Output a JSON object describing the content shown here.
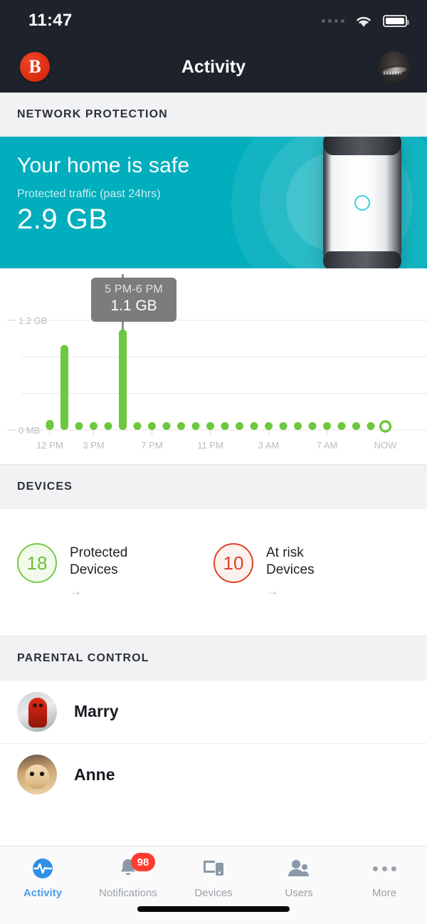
{
  "status_bar": {
    "time": "11:47",
    "signal_icon": "signal-dots-icon",
    "wifi_icon": "wifi-icon",
    "battery_icon": "battery-icon"
  },
  "nav_bar": {
    "brand_letter": "B",
    "title": "Activity",
    "avatar_icon": "user-avatar"
  },
  "sections": {
    "network_protection": "NETWORK PROTECTION",
    "devices": "DEVICES",
    "parental_control": "PARENTAL CONTROL"
  },
  "hero": {
    "title": "Your home is safe",
    "subtitle": "Protected traffic (past 24hrs)",
    "value": "2.9 GB",
    "accent_color": "#00aebd",
    "router_icon": "router-device-icon"
  },
  "tooltip": {
    "range": "5 PM-6 PM",
    "value": "1.1 GB"
  },
  "devices": [
    {
      "count": "18",
      "line1": "Protected",
      "line2": "Devices",
      "color": "#7ac943",
      "arrow": "→"
    },
    {
      "count": "10",
      "line1": "At risk",
      "line2": "Devices",
      "color": "#dc4327",
      "arrow": "→"
    }
  ],
  "parental_control": [
    {
      "name": "Marry",
      "avatar": "avatar-marry"
    },
    {
      "name": "Anne",
      "avatar": "avatar-anne"
    }
  ],
  "tabs": [
    {
      "label": "Activity",
      "icon": "activity-pulse-icon",
      "active": true,
      "badge": null
    },
    {
      "label": "Notifications",
      "icon": "bell-icon",
      "active": false,
      "badge": "98"
    },
    {
      "label": "Devices",
      "icon": "devices-icon",
      "active": false,
      "badge": null
    },
    {
      "label": "Users",
      "icon": "users-icon",
      "active": false,
      "badge": null
    },
    {
      "label": "More",
      "icon": "ellipsis-icon",
      "active": false,
      "badge": null
    }
  ],
  "chart_data": {
    "type": "bar",
    "title": "",
    "xlabel": "",
    "ylabel": "",
    "ylim": [
      0,
      1.45
    ],
    "y_unit": "GB",
    "grid": true,
    "legend": false,
    "bar_color": "#6cc83c",
    "y_tick_labels": [
      "0 MB",
      "1.2 GB"
    ],
    "y_tick_values": [
      0,
      1.2
    ],
    "gridline_values": [
      0,
      0.4,
      0.8,
      1.2
    ],
    "x_tick_labels": [
      "12 PM",
      "3 PM",
      "7 PM",
      "11 PM",
      "3 AM",
      "7 AM",
      "NOW"
    ],
    "x_tick_hours": [
      0,
      3,
      7,
      11,
      15,
      19,
      23
    ],
    "highlight_index": 5,
    "highlight_label": "5 PM-6 PM",
    "highlight_value": "1.1 GB",
    "last_point_hollow": true,
    "categories": [
      "12 PM",
      "1 PM",
      "2 PM",
      "3 PM",
      "4 PM",
      "5 PM",
      "6 PM",
      "7 PM",
      "8 PM",
      "9 PM",
      "10 PM",
      "11 PM",
      "12 AM",
      "1 AM",
      "2 AM",
      "3 AM",
      "4 AM",
      "5 AM",
      "6 AM",
      "7 AM",
      "8 AM",
      "9 AM",
      "10 AM",
      "NOW"
    ],
    "values": [
      0.11,
      0.93,
      0.07,
      0.01,
      0.01,
      1.1,
      0.01,
      0.01,
      0.01,
      0.01,
      0.01,
      0.01,
      0.01,
      0.01,
      0.01,
      0.01,
      0.01,
      0.01,
      0.01,
      0.01,
      0.01,
      0.01,
      0.01,
      0.01
    ]
  }
}
